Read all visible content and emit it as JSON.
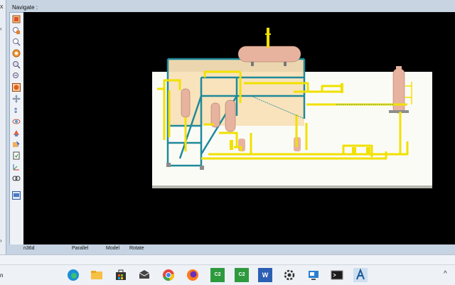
{
  "navigator": {
    "label": "Navigate :"
  },
  "window": {
    "close_glyph": "x"
  },
  "status": {
    "view_name": "n36d",
    "projection": "Parallel",
    "mode": "Model",
    "action": "Rotate"
  },
  "taskbar": {
    "partial_text": "n",
    "chevron_glyph": "^",
    "apps": [
      {
        "name": "edge-icon",
        "label": ""
      },
      {
        "name": "file-explorer-icon",
        "label": ""
      },
      {
        "name": "store-icon",
        "label": ""
      },
      {
        "name": "mail-icon",
        "label": ""
      },
      {
        "name": "chrome-icon",
        "label": ""
      },
      {
        "name": "firefox-icon",
        "label": ""
      },
      {
        "name": "c2-app-icon",
        "label": "C2"
      },
      {
        "name": "c2-app-icon-2",
        "label": "C2"
      },
      {
        "name": "word-icon",
        "label": "W"
      },
      {
        "name": "settings-icon",
        "label": ""
      },
      {
        "name": "remote-desktop-icon",
        "label": ""
      },
      {
        "name": "terminal-icon",
        "label": ""
      },
      {
        "name": "cad-app-icon",
        "label": ""
      }
    ]
  },
  "toolbar": {
    "tools": [
      "zoom-extents-icon",
      "zoom-window-icon",
      "zoom-previous-icon",
      "pan-view-icon",
      "zoom-in-icon",
      "zoom-out-icon",
      "shaded-view-icon",
      "move-icon",
      "walk-icon",
      "orbit-icon",
      "fly-icon",
      "select-icon",
      "clip-icon",
      "axis-icon",
      "camera-icon",
      "settings-view-icon"
    ]
  },
  "colors": {
    "pipe": "#f1e000",
    "steel": "#1f8a9a",
    "vessel": "#e7b39e",
    "platform": "#f8e2b8",
    "background": "#000000",
    "ground": "#fbfbf6"
  }
}
